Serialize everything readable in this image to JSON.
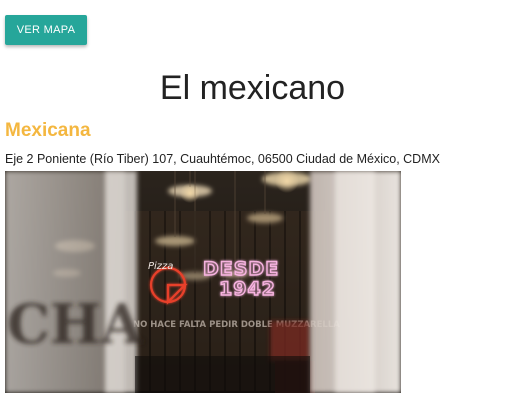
{
  "toolbar": {
    "map_button_label": "VER MAPA"
  },
  "restaurant": {
    "name": "El mexicano",
    "category": "Mexicana",
    "address": "Eje 2 Poniente (Río Tiber) 107, Cuauhtémoc, 06500 Ciudad de México, CDMX"
  },
  "photo": {
    "neon_brand": "Pizza",
    "neon_line1": "DESDE",
    "neon_line2": "1942",
    "banner_text": "NO HACE FALTA PEDIR DOBLE MUZZARELLA",
    "wall_letters": "CHA"
  },
  "colors": {
    "button": "#26a69a",
    "category": "#f4b740",
    "neon_pink": "#f7b3e0",
    "neon_red": "#e8412c"
  }
}
